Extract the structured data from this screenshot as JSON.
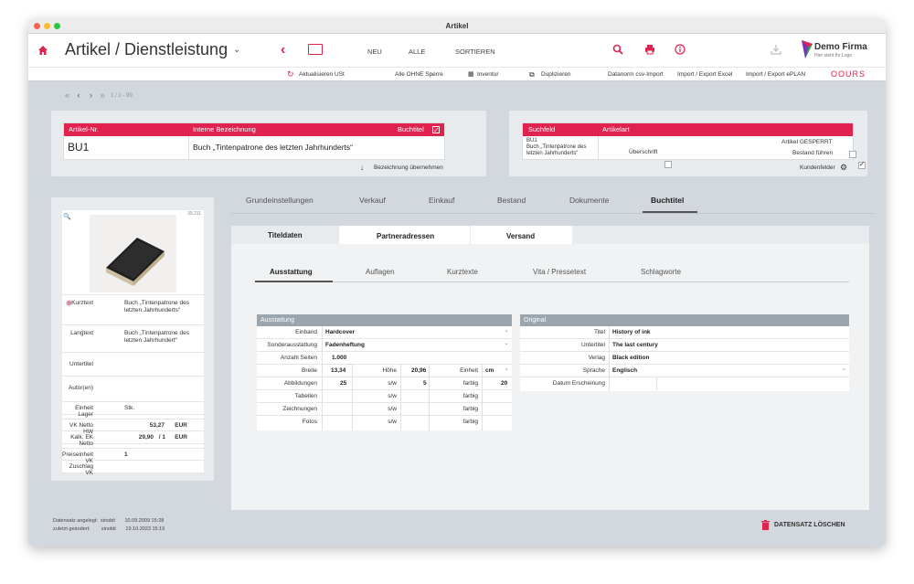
{
  "window": {
    "title": "Artikel"
  },
  "toolbar": {
    "title": "Artikel / Dienstleistung",
    "neu": "NEU",
    "alle": "ALLE",
    "sortieren": "SORTIEREN",
    "brand_name": "Demo Firma",
    "brand_tagline": "Hier steht Ihr Logo"
  },
  "subbar": {
    "aktualisieren": "Aktualisieren USt",
    "alle_ohne_sperre": "Alle OHNE Sperre",
    "inventur": "Inventur",
    "duplizieren": "Duplizieren",
    "datanorm": "Datanorm csv-Import",
    "excel": "Import / Export Excel",
    "eplan": "Import / Export ePLAN",
    "logo": "OOURS"
  },
  "pager": {
    "text": "1 / 1 - 99"
  },
  "article": {
    "h_nr": "Artikel-Nr.",
    "h_bezeichnung": "Interne Bezeichnung",
    "h_buchtitel": "Buchtitel",
    "nr": "BU1",
    "bezeichnung": "Buch „Tintenpatrone des letzten Jahrhunderts“",
    "uebernehmen": "Bezeichnung übernehmen"
  },
  "search_panel": {
    "h_suchfeld": "Suchfeld",
    "h_artikelart": "Artikelart",
    "suchfeld": "BU1\nBuch „Tintenpatrone des letzten Jahrhunderts“",
    "ueberschrift": "Überschrift",
    "gesperrt": "Artikel GESPERRT",
    "bestand": "Bestand führen",
    "kundenfelder": "Kundenfelder"
  },
  "left_card": {
    "img_id": "39.211",
    "kurztext_label": "Kurztext",
    "kurztext": "Buch „Tintenpatrone des letzten Jahrhunderts“",
    "langtext_label": "Langtext",
    "langtext": "Buch „Tintenpatrone des letzten Jahrhundert“",
    "untertitel_label": "Untertitel",
    "autoren_label": "Autor(en)",
    "einheit_label": "Einheit Lager",
    "einheit": "Stk.",
    "vk_label": "VK Netto HW",
    "vk": "53,27",
    "vk_cur": "EUR",
    "ek_label": "Kalk. EK Netto",
    "ek": "29,90",
    "ek_div": "/ 1",
    "ek_cur": "EUR",
    "preiseinheit_label": "Preiseinheit VK",
    "preiseinheit": "1",
    "zuschlag_label": "Zuschlag VK"
  },
  "main_tabs": [
    "Grundeinstellungen",
    "Verkauf",
    "Einkauf",
    "Bestand",
    "Dokumente",
    "Buchtitel"
  ],
  "sub_tabs": [
    "Titeldaten",
    "Partneradressen",
    "Versand"
  ],
  "inner_tabs": [
    "Ausstattung",
    "Auflagen",
    "Kurztexte",
    "Vita / Pressetext",
    "Schlagworte"
  ],
  "ausstattung": {
    "header": "Ausstattung",
    "einband_label": "Einband",
    "einband": "Hardcover",
    "sonder_label": "Sonderausstattung",
    "sonder": "Fadenheftung",
    "seiten_label": "Anzahl Seiten",
    "seiten": "1.000",
    "breite_label": "Breite",
    "breite": "13,34",
    "hoehe_label": "Höhe",
    "hoehe": "20,96",
    "einheit_label": "Einheit",
    "einheit": "cm",
    "abb_label": "Abbildungen",
    "abb": "25",
    "sw": "s/w",
    "abb_sw": "5",
    "farbig": "farbig",
    "abb_farbig": "20",
    "tabellen_label": "Tabellen",
    "zeichnungen_label": "Zeichnungen",
    "fotos_label": "Fotos"
  },
  "original": {
    "header": "Original",
    "titel_label": "Titel",
    "titel": "History of ink",
    "untertitel_label": "Untertitel",
    "untertitel": "The last century",
    "verlag_label": "Verlag",
    "verlag": "Black edition",
    "sprache_label": "Sprache",
    "sprache": "Englisch",
    "datum_label": "Datum Erscheinung"
  },
  "footer": {
    "angelegt_label": "Datensatz angelegt:",
    "angelegt_user": "sinobit",
    "angelegt_date": "10.09.2009 15:28",
    "geaendert_label": "zuletzt geändert:",
    "geaendert_user": "sinobit",
    "geaendert_date": "19.10.2023 15:19",
    "delete": "DATENSATZ LÖSCHEN"
  },
  "colors": {
    "accent": "#e0224f",
    "table_head": "#9aa5ad"
  }
}
